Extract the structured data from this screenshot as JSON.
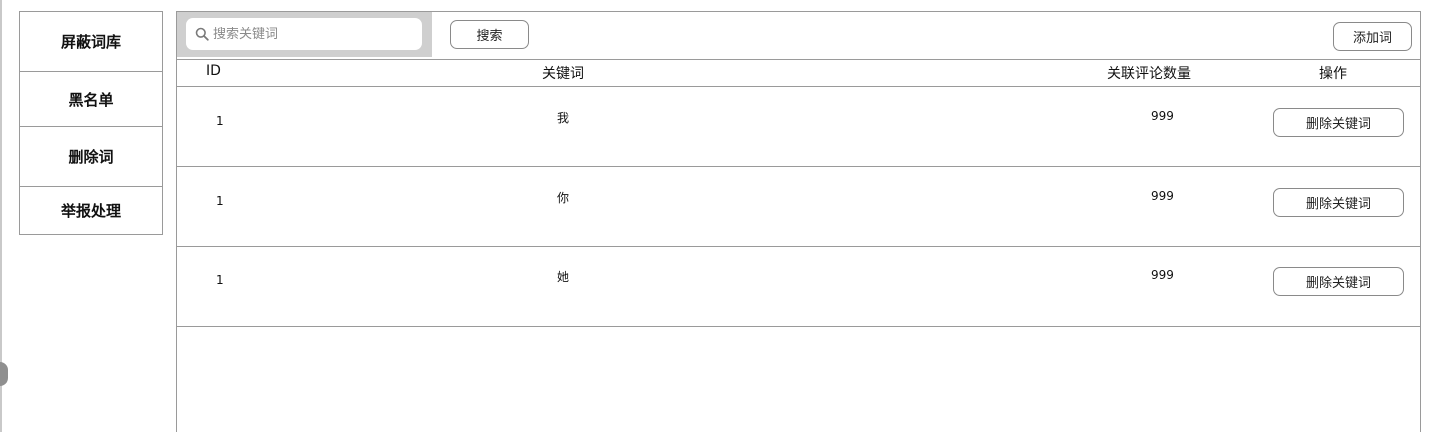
{
  "sidebar": {
    "items": [
      {
        "label": "屏蔽词库"
      },
      {
        "label": "黑名单"
      },
      {
        "label": "删除词"
      },
      {
        "label": "举报处理"
      }
    ]
  },
  "toolbar": {
    "search_placeholder": "搜索关键词",
    "search_icon": "search-icon",
    "search_label": "搜索",
    "add_label": "添加词"
  },
  "table": {
    "columns": [
      "ID",
      "关键词",
      "关联评论数量",
      "操作"
    ],
    "rows": [
      {
        "id": "1",
        "keyword": "我",
        "count": "999",
        "action": "删除关键词"
      },
      {
        "id": "1",
        "keyword": "你",
        "count": "999",
        "action": "删除关键词"
      },
      {
        "id": "1",
        "keyword": "她",
        "count": "999",
        "action": "删除关键词"
      }
    ]
  }
}
